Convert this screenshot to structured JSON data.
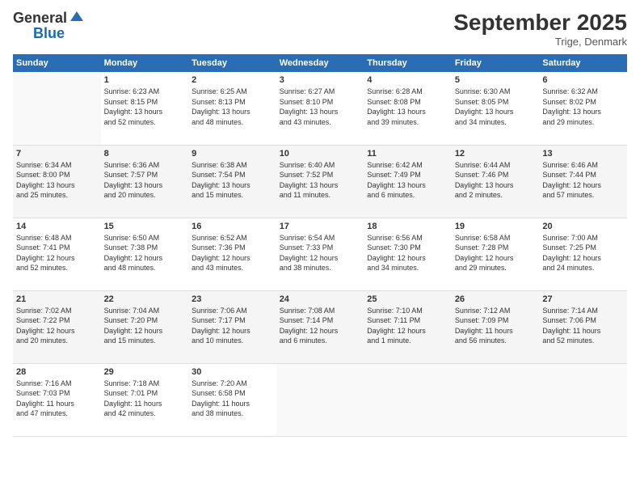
{
  "header": {
    "logo_general": "General",
    "logo_blue": "Blue",
    "month": "September 2025",
    "location": "Trige, Denmark"
  },
  "columns": [
    "Sunday",
    "Monday",
    "Tuesday",
    "Wednesday",
    "Thursday",
    "Friday",
    "Saturday"
  ],
  "weeks": [
    [
      {
        "num": "",
        "info": ""
      },
      {
        "num": "1",
        "info": "Sunrise: 6:23 AM\nSunset: 8:15 PM\nDaylight: 13 hours\nand 52 minutes."
      },
      {
        "num": "2",
        "info": "Sunrise: 6:25 AM\nSunset: 8:13 PM\nDaylight: 13 hours\nand 48 minutes."
      },
      {
        "num": "3",
        "info": "Sunrise: 6:27 AM\nSunset: 8:10 PM\nDaylight: 13 hours\nand 43 minutes."
      },
      {
        "num": "4",
        "info": "Sunrise: 6:28 AM\nSunset: 8:08 PM\nDaylight: 13 hours\nand 39 minutes."
      },
      {
        "num": "5",
        "info": "Sunrise: 6:30 AM\nSunset: 8:05 PM\nDaylight: 13 hours\nand 34 minutes."
      },
      {
        "num": "6",
        "info": "Sunrise: 6:32 AM\nSunset: 8:02 PM\nDaylight: 13 hours\nand 29 minutes."
      }
    ],
    [
      {
        "num": "7",
        "info": "Sunrise: 6:34 AM\nSunset: 8:00 PM\nDaylight: 13 hours\nand 25 minutes."
      },
      {
        "num": "8",
        "info": "Sunrise: 6:36 AM\nSunset: 7:57 PM\nDaylight: 13 hours\nand 20 minutes."
      },
      {
        "num": "9",
        "info": "Sunrise: 6:38 AM\nSunset: 7:54 PM\nDaylight: 13 hours\nand 15 minutes."
      },
      {
        "num": "10",
        "info": "Sunrise: 6:40 AM\nSunset: 7:52 PM\nDaylight: 13 hours\nand 11 minutes."
      },
      {
        "num": "11",
        "info": "Sunrise: 6:42 AM\nSunset: 7:49 PM\nDaylight: 13 hours\nand 6 minutes."
      },
      {
        "num": "12",
        "info": "Sunrise: 6:44 AM\nSunset: 7:46 PM\nDaylight: 13 hours\nand 2 minutes."
      },
      {
        "num": "13",
        "info": "Sunrise: 6:46 AM\nSunset: 7:44 PM\nDaylight: 12 hours\nand 57 minutes."
      }
    ],
    [
      {
        "num": "14",
        "info": "Sunrise: 6:48 AM\nSunset: 7:41 PM\nDaylight: 12 hours\nand 52 minutes."
      },
      {
        "num": "15",
        "info": "Sunrise: 6:50 AM\nSunset: 7:38 PM\nDaylight: 12 hours\nand 48 minutes."
      },
      {
        "num": "16",
        "info": "Sunrise: 6:52 AM\nSunset: 7:36 PM\nDaylight: 12 hours\nand 43 minutes."
      },
      {
        "num": "17",
        "info": "Sunrise: 6:54 AM\nSunset: 7:33 PM\nDaylight: 12 hours\nand 38 minutes."
      },
      {
        "num": "18",
        "info": "Sunrise: 6:56 AM\nSunset: 7:30 PM\nDaylight: 12 hours\nand 34 minutes."
      },
      {
        "num": "19",
        "info": "Sunrise: 6:58 AM\nSunset: 7:28 PM\nDaylight: 12 hours\nand 29 minutes."
      },
      {
        "num": "20",
        "info": "Sunrise: 7:00 AM\nSunset: 7:25 PM\nDaylight: 12 hours\nand 24 minutes."
      }
    ],
    [
      {
        "num": "21",
        "info": "Sunrise: 7:02 AM\nSunset: 7:22 PM\nDaylight: 12 hours\nand 20 minutes."
      },
      {
        "num": "22",
        "info": "Sunrise: 7:04 AM\nSunset: 7:20 PM\nDaylight: 12 hours\nand 15 minutes."
      },
      {
        "num": "23",
        "info": "Sunrise: 7:06 AM\nSunset: 7:17 PM\nDaylight: 12 hours\nand 10 minutes."
      },
      {
        "num": "24",
        "info": "Sunrise: 7:08 AM\nSunset: 7:14 PM\nDaylight: 12 hours\nand 6 minutes."
      },
      {
        "num": "25",
        "info": "Sunrise: 7:10 AM\nSunset: 7:11 PM\nDaylight: 12 hours\nand 1 minute."
      },
      {
        "num": "26",
        "info": "Sunrise: 7:12 AM\nSunset: 7:09 PM\nDaylight: 11 hours\nand 56 minutes."
      },
      {
        "num": "27",
        "info": "Sunrise: 7:14 AM\nSunset: 7:06 PM\nDaylight: 11 hours\nand 52 minutes."
      }
    ],
    [
      {
        "num": "28",
        "info": "Sunrise: 7:16 AM\nSunset: 7:03 PM\nDaylight: 11 hours\nand 47 minutes."
      },
      {
        "num": "29",
        "info": "Sunrise: 7:18 AM\nSunset: 7:01 PM\nDaylight: 11 hours\nand 42 minutes."
      },
      {
        "num": "30",
        "info": "Sunrise: 7:20 AM\nSunset: 6:58 PM\nDaylight: 11 hours\nand 38 minutes."
      },
      {
        "num": "",
        "info": ""
      },
      {
        "num": "",
        "info": ""
      },
      {
        "num": "",
        "info": ""
      },
      {
        "num": "",
        "info": ""
      }
    ]
  ]
}
